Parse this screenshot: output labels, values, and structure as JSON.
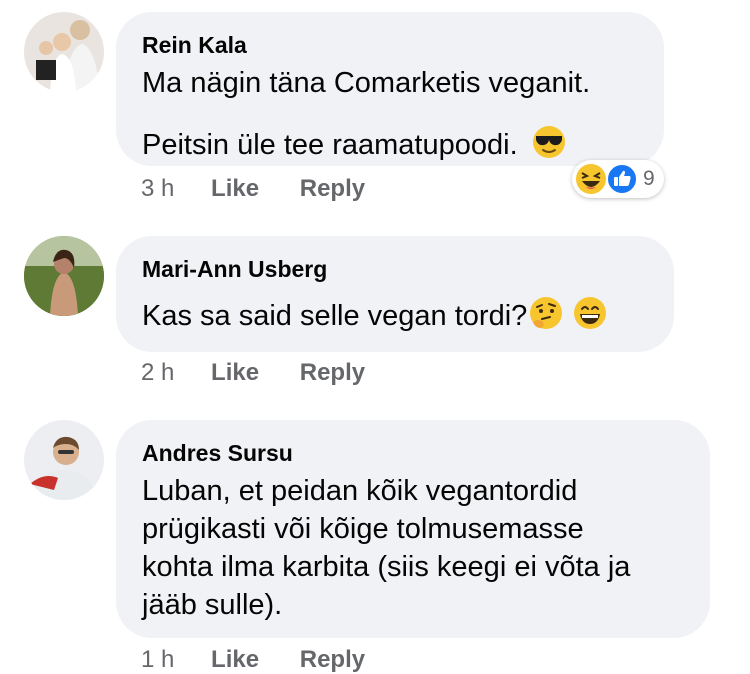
{
  "comments": [
    {
      "author": "Rein Kala",
      "lines": [
        "Ma nägin täna Comarketis veganit.",
        "Peitsin üle tee raamatupoodi."
      ],
      "emoji": [
        "sunglasses-emoji"
      ],
      "time": "3 h",
      "like_label": "Like",
      "reply_label": "Reply",
      "reactions": {
        "icons": [
          "laughing-emoji",
          "thumbs-up-icon"
        ],
        "count": "9"
      }
    },
    {
      "author": "Mari-Ann Usberg",
      "lines": [
        "Kas sa said selle vegan tordi?"
      ],
      "emoji": [
        "thinking-emoji",
        "grinning-emoji"
      ],
      "time": "2 h",
      "like_label": "Like",
      "reply_label": "Reply"
    },
    {
      "author": "Andres Sursu",
      "lines": [
        "Luban, et peidan kõik vegantordid",
        "prügikasti või kõige tolmusemasse",
        "kohta ilma karbita (siis keegi ei võta ja",
        "jääb sulle)."
      ],
      "time": "1 h",
      "like_label": "Like",
      "reply_label": "Reply"
    }
  ],
  "colors": {
    "bubble": "#f0f2f5",
    "text": "#050505",
    "secondary": "#65676b",
    "like_blue": "#1877f2",
    "emoji_yellow": "#f7c52e"
  }
}
